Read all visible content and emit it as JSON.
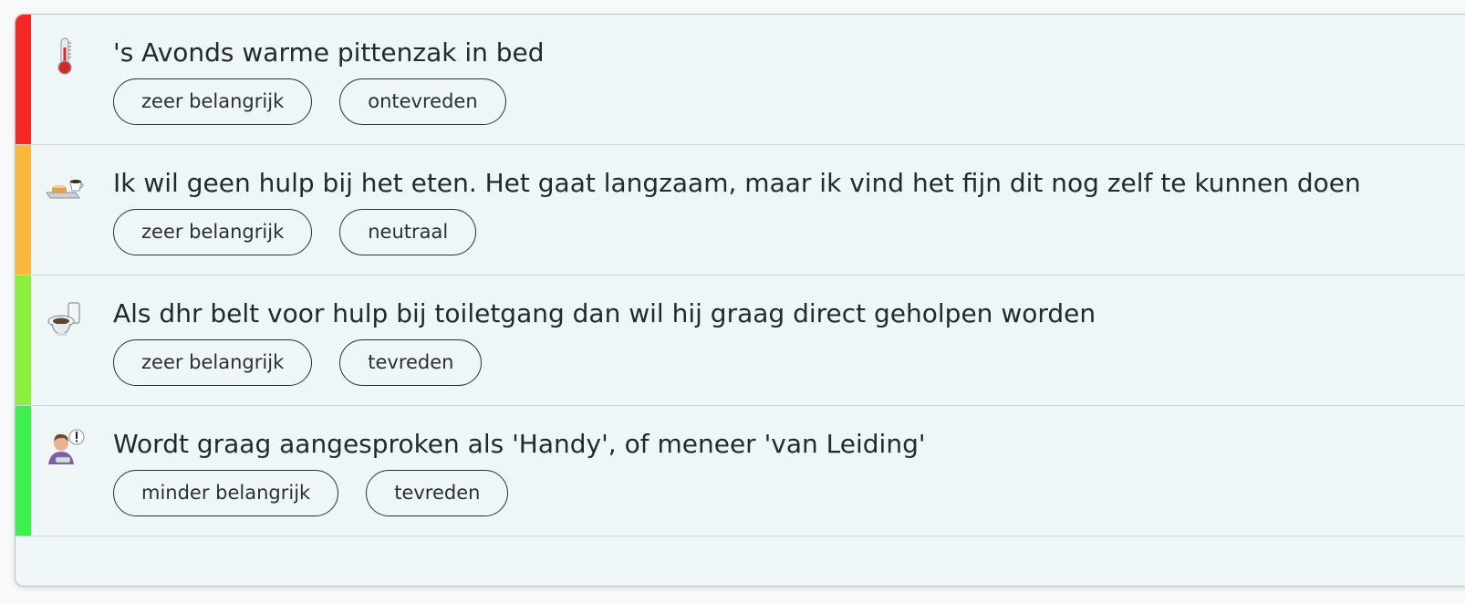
{
  "items": [
    {
      "icon": "thermometer-icon",
      "color": "#f52727",
      "title": "'s Avonds warme pittenzak in bed",
      "importance": "zeer belangrijk",
      "status": "ontevreden"
    },
    {
      "icon": "meal-tray-icon",
      "color": "#fbb73b",
      "title": "Ik wil geen hulp bij het eten. Het gaat langzaam, maar ik vind het fijn dit nog zelf te kunnen doen",
      "importance": "zeer belangrijk",
      "status": "neutraal"
    },
    {
      "icon": "toilet-icon",
      "color": "#8af03d",
      "title": "Als dhr belt voor hulp bij toiletgang dan wil hij graag direct geholpen worden",
      "importance": "zeer belangrijk",
      "status": "tevreden"
    },
    {
      "icon": "person-speaking-icon",
      "color": "#3bef4d",
      "title": "Wordt graag aangesproken als 'Handy', of meneer 'van Leiding'",
      "importance": "minder belangrijk",
      "status": "tevreden"
    }
  ]
}
